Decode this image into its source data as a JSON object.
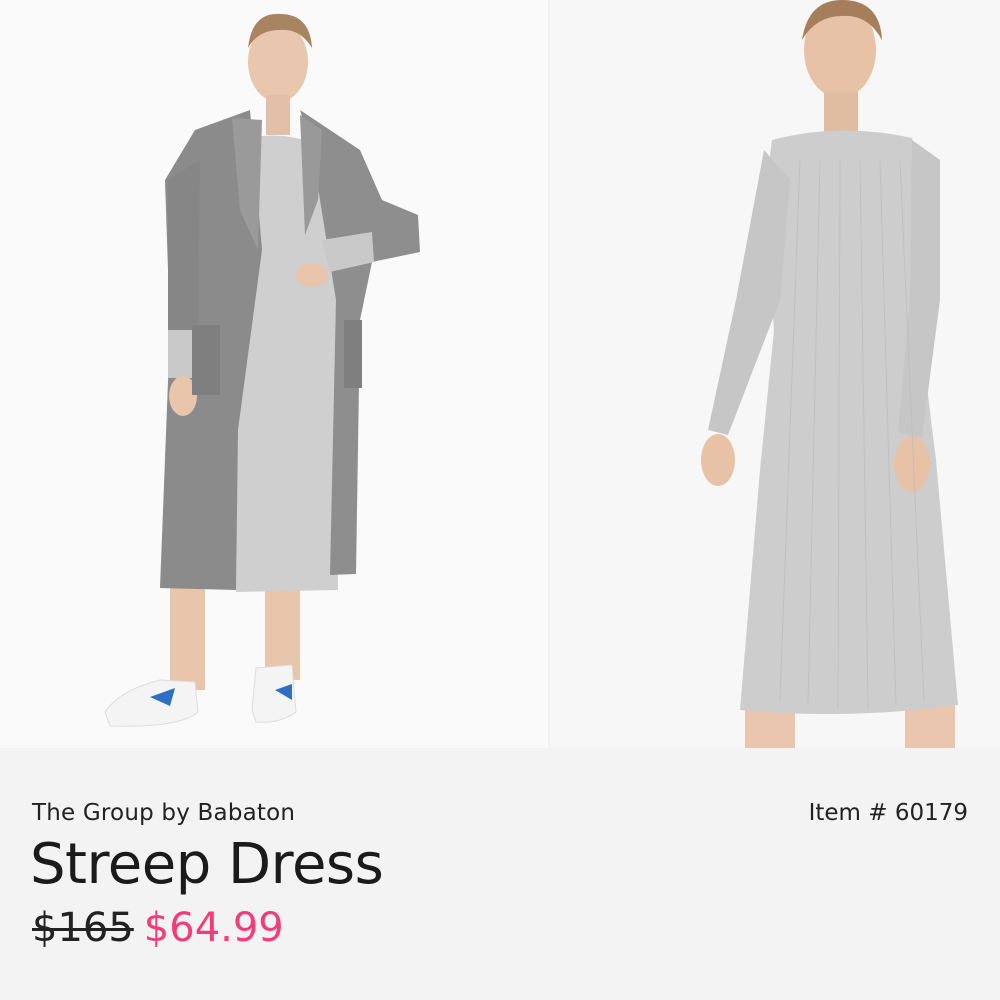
{
  "product": {
    "brand": "The Group by Babaton",
    "item_number": "Item # 60179",
    "name": "Streep Dress",
    "original_price": "$165",
    "sale_price": "$64.99",
    "sale_color": "#f23d7a"
  },
  "images": [
    {
      "name": "product-photo-coat-look"
    },
    {
      "name": "product-photo-dress-front"
    }
  ]
}
